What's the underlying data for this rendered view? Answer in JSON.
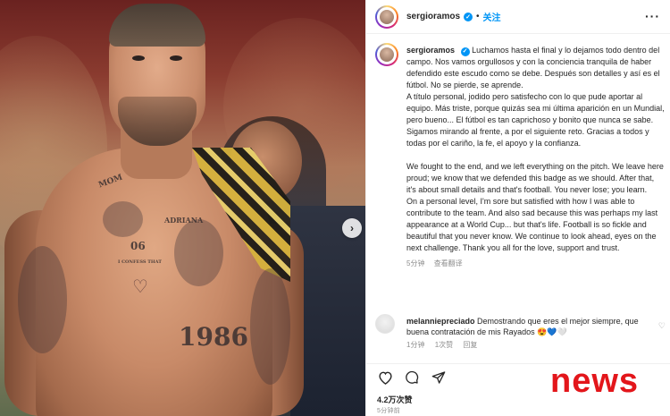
{
  "post": {
    "username": "sergioramos",
    "follow_label": "关注",
    "more_label": "···",
    "caption_es": [
      "Luchamos hasta el final y lo dejamos todo dentro del campo. Nos vamos orgullosos y con la conciencia tranquila de haber defendido este escudo como se debe. Después son detalles y así es el fútbol. No se pierde, se aprende.",
      "A título personal, jodido pero satisfecho con lo que pude aportar al equipo. Más triste, porque quizás sea mi última aparición en un Mundial, pero bueno... El fútbol es tan caprichoso y bonito que nunca se sabe. Sigamos mirando al frente, a por el siguiente reto. Gracias a todos y todas por el cariño, la fe, el apoyo y la confianza."
    ],
    "caption_en": [
      "We fought to the end, and we left everything on the pitch. We leave here proud; we know that we defended this badge as we should. After that, it's about small details and that's football. You never lose; you learn.",
      "On a personal level, I'm sore but satisfied with how I was able to contribute to the team. And also sad because this was perhaps my last appearance at a World Cup... but that's life. Football is so fickle and beautiful that you never know. We continue to look ahead, eyes on the next challenge. Thank you all for the love, support and trust."
    ],
    "caption_time": "5分钟",
    "translate_label": "查看翻译",
    "likes": "4.2万次赞",
    "time_bottom": "5分钟前"
  },
  "comment": {
    "username": "melanniepreciado",
    "text": "Demostrando que eres el mejor siempre, que buena contratación de mis Rayados",
    "emojis": "😍💙🤍",
    "time": "1分钟",
    "likes": "1次赞",
    "reply_label": "回复"
  },
  "photo": {
    "tattoos": {
      "mom": "MOM",
      "adriana": "ADRIANA",
      "num06": "06",
      "year": "1986",
      "phrase": "I CONFESS THAT"
    },
    "next_icon": "chevron-right-icon"
  },
  "watermark": "news",
  "colors": {
    "accent": "#0095f6",
    "watermark": "#e3161b",
    "muted": "#8e8e8e"
  }
}
